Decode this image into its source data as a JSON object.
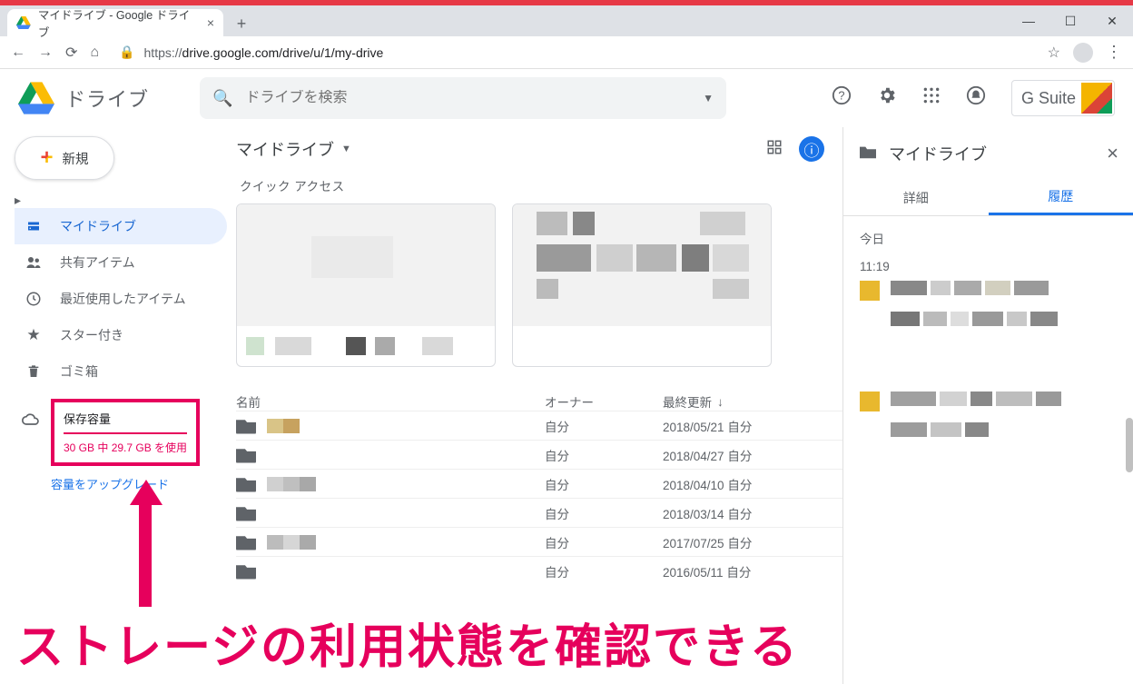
{
  "browser": {
    "tab_title": "マイドライブ - Google ドライブ",
    "url_scheme": "https://",
    "url_rest": "drive.google.com/drive/u/1/my-drive"
  },
  "header": {
    "product": "ドライブ",
    "search_placeholder": "ドライブを検索",
    "gsuite": "G Suite"
  },
  "sidebar": {
    "new_label": "新規",
    "items": [
      {
        "label": "マイドライブ",
        "selected": true
      },
      {
        "label": "共有アイテム"
      },
      {
        "label": "最近使用したアイテム"
      },
      {
        "label": "スター付き"
      },
      {
        "label": "ゴミ箱"
      }
    ],
    "storage": {
      "title": "保存容量",
      "usage": "30 GB 中 29.7 GB を使用",
      "upgrade": "容量をアップグレード"
    }
  },
  "main": {
    "breadcrumb": "マイドライブ",
    "quick_access_label": "クイック アクセス",
    "columns": {
      "name": "名前",
      "owner": "オーナー",
      "modified": "最終更新"
    },
    "owner_self": "自分",
    "rows": [
      {
        "date": "2018/05/21",
        "by": "自分"
      },
      {
        "date": "2018/04/27",
        "by": "自分"
      },
      {
        "date": "2018/04/10",
        "by": "自分"
      },
      {
        "date": "2018/03/14",
        "by": "自分"
      },
      {
        "date": "2017/07/25",
        "by": "自分"
      },
      {
        "date": "2016/05/11",
        "by": "自分"
      }
    ]
  },
  "detail": {
    "title": "マイドライブ",
    "tabs": {
      "detail": "詳細",
      "history": "履歴"
    },
    "today": "今日",
    "time1": "11:19"
  },
  "annotation": {
    "caption": "ストレージの利用状態を確認できる"
  }
}
